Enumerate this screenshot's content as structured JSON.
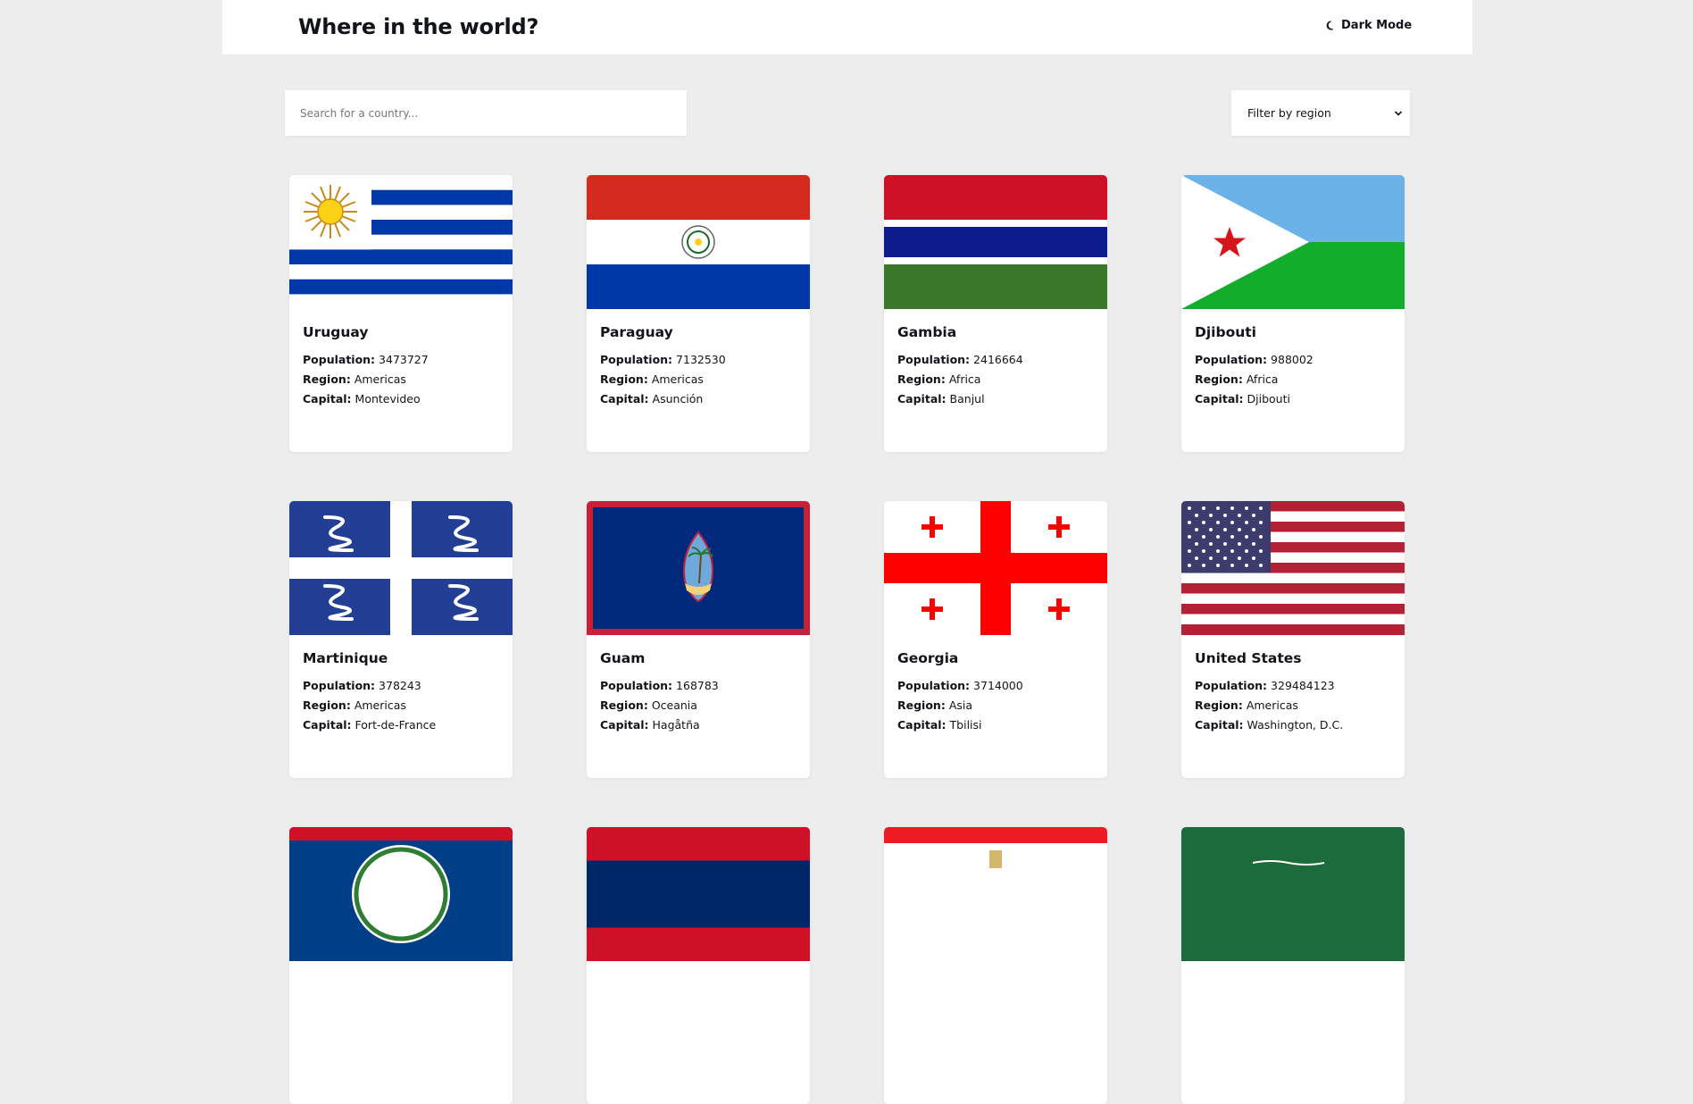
{
  "header": {
    "title": "Where in the world?",
    "dark_mode_label": "Dark Mode"
  },
  "search": {
    "placeholder": "Search for a country..."
  },
  "filter": {
    "label": "Filter by region"
  },
  "labels": {
    "population": "Population:",
    "region": "Region:",
    "capital": "Capital:"
  },
  "countries": [
    {
      "name": "Uruguay",
      "population": "3473727",
      "region": "Americas",
      "capital": "Montevideo"
    },
    {
      "name": "Paraguay",
      "population": "7132530",
      "region": "Americas",
      "capital": "Asunción"
    },
    {
      "name": "Gambia",
      "population": "2416664",
      "region": "Africa",
      "capital": "Banjul"
    },
    {
      "name": "Djibouti",
      "population": "988002",
      "region": "Africa",
      "capital": "Djibouti"
    },
    {
      "name": "Martinique",
      "population": "378243",
      "region": "Americas",
      "capital": "Fort-de-France"
    },
    {
      "name": "Guam",
      "population": "168783",
      "region": "Oceania",
      "capital": "Hagåtña"
    },
    {
      "name": "Georgia",
      "population": "3714000",
      "region": "Asia",
      "capital": "Tbilisi"
    },
    {
      "name": "United States",
      "population": "329484123",
      "region": "Americas",
      "capital": "Washington, D.C."
    }
  ],
  "flag_icons": [
    "uruguay-flag",
    "paraguay-flag",
    "gambia-flag",
    "djibouti-flag",
    "martinique-flag",
    "guam-flag",
    "georgia-flag",
    "united-states-flag",
    "belize-flag",
    "laos-flag",
    "peru-flag",
    "saudi-arabia-flag"
  ]
}
